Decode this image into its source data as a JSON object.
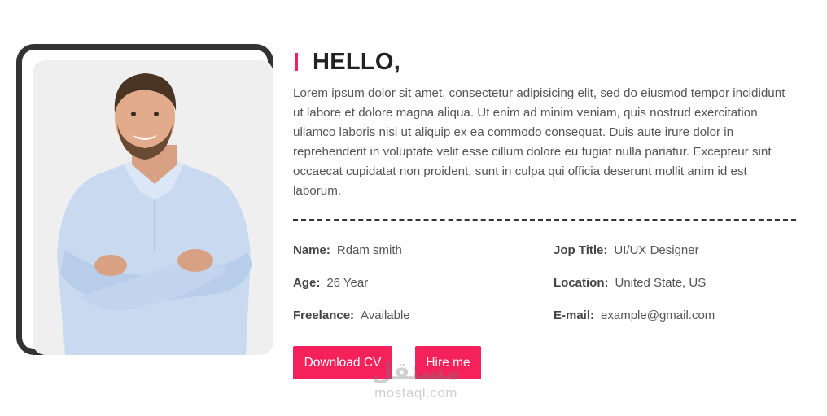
{
  "about": {
    "heading": "HELLO,",
    "intro": "Lorem ipsum dolor sit amet, consectetur adipisicing elit, sed do eiusmod tempor incididunt ut labore et dolore magna aliqua. Ut enim ad minim veniam, quis nostrud exercitation ullamco laboris nisi ut aliquip ex ea commodo consequat. Duis aute irure dolor in reprehenderit in voluptate velit esse cillum dolore eu fugiat nulla pariatur. Excepteur sint occaecat cupidatat non proident, sunt in culpa qui officia deserunt mollit anim id est laborum."
  },
  "info": {
    "name": {
      "label": "Name:",
      "value": "Rdam smith"
    },
    "job": {
      "label": "Jop Title:",
      "value": "UI/UX Designer"
    },
    "age": {
      "label": "Age:",
      "value": "26 Year"
    },
    "location": {
      "label": "Location:",
      "value": "United State, US"
    },
    "freelance": {
      "label": "Freelance:",
      "value": "Available"
    },
    "email": {
      "label": "E-mail:",
      "value": "example@gmail.com"
    }
  },
  "buttons": {
    "download_cv": "Download CV",
    "hire_me": "Hire me"
  },
  "watermark": {
    "arabic": "مستقل",
    "latin": "mostaql.com"
  },
  "colors": {
    "accent": "#f5215b",
    "frame": "#333333",
    "photo_bg": "#efefef"
  }
}
